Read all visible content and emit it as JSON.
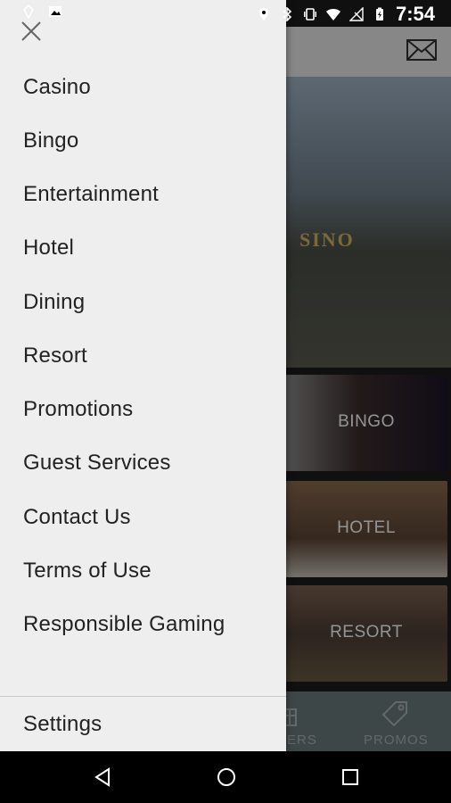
{
  "status_bar": {
    "time": "7:54",
    "icons": [
      "location-icon",
      "bluetooth-icon",
      "vibrate-icon",
      "wifi-icon",
      "no-signal-icon",
      "battery-icon",
      "image-notification-icon",
      "android-debug-icon"
    ]
  },
  "drawer": {
    "items": [
      {
        "label": "Casino"
      },
      {
        "label": "Bingo"
      },
      {
        "label": "Entertainment"
      },
      {
        "label": "Hotel"
      },
      {
        "label": "Dining"
      },
      {
        "label": "Resort"
      },
      {
        "label": "Promotions"
      },
      {
        "label": "Guest Services"
      },
      {
        "label": "Contact Us"
      },
      {
        "label": "Terms of Use"
      },
      {
        "label": "Responsible Gaming"
      }
    ],
    "settings_label": "Settings"
  },
  "background": {
    "hero_sign": "SINO",
    "tiles": {
      "bingo": "BINGO",
      "hotel": "HOTEL",
      "resort": "RESORT"
    },
    "bottom_nav": {
      "others_label": "ERS",
      "promos_label": "PROMOS"
    }
  },
  "colors": {
    "drawer_bg": "#eeeeee",
    "nav_bar_bg": "#6b7b7a",
    "text": "#222222"
  }
}
